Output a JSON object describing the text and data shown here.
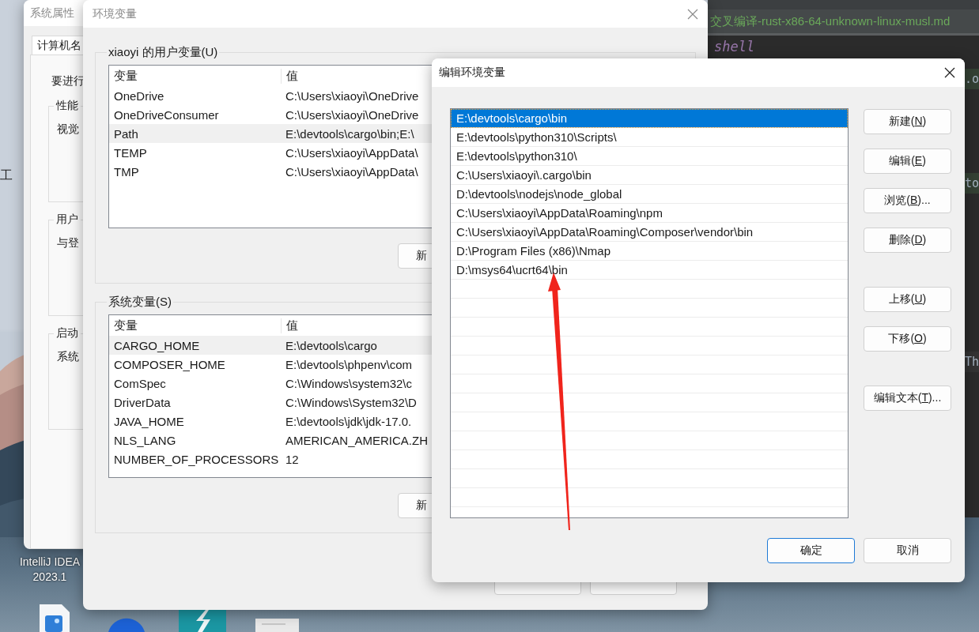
{
  "desktop": {
    "edge_label": "工",
    "shortcut": {
      "lines": [
        "IntelliJ IDEA",
        "2023.1"
      ]
    }
  },
  "ide": {
    "tab": {
      "label": "交叉编译-rust-x86-64-unknown-linux-musl.md",
      "selected": true
    },
    "lines": [
      {
        "text": "shell",
        "kind": "keyword",
        "highlighted": false
      },
      {
        "text": ".o",
        "kind": "edge",
        "highlighted": true
      },
      {
        "text": "to",
        "kind": "edge",
        "highlighted": true
      },
      {
        "text": "Th",
        "kind": "edge",
        "highlighted": false
      }
    ]
  },
  "system_properties": {
    "title": "系统属性",
    "tabs": [
      {
        "label": "计算机名",
        "selected": true
      }
    ],
    "intro": "要进行",
    "groups": [
      {
        "title": "性能",
        "text": "视觉"
      },
      {
        "title": "用户",
        "text": "与登"
      },
      {
        "title": "启动",
        "text": "系统"
      }
    ]
  },
  "env_window": {
    "title": "环境变量",
    "sections": [
      {
        "title": "xiaoyi 的用户变量(U)",
        "columns": [
          "变量",
          "值"
        ],
        "button": "新",
        "rows": [
          {
            "name": "OneDrive",
            "value": "C:\\Users\\xiaoyi\\OneDrive",
            "selected": false
          },
          {
            "name": "OneDriveConsumer",
            "value": "C:\\Users\\xiaoyi\\OneDrive",
            "selected": false
          },
          {
            "name": "Path",
            "value": "E:\\devtools\\cargo\\bin;E:\\",
            "selected": true
          },
          {
            "name": "TEMP",
            "value": "C:\\Users\\xiaoyi\\AppData\\",
            "selected": false
          },
          {
            "name": "TMP",
            "value": "C:\\Users\\xiaoyi\\AppData\\",
            "selected": false
          }
        ]
      },
      {
        "title": "系统变量(S)",
        "columns": [
          "变量",
          "值"
        ],
        "button": "新",
        "rows": [
          {
            "name": "CARGO_HOME",
            "value": "E:\\devtools\\cargo",
            "selected": true
          },
          {
            "name": "COMPOSER_HOME",
            "value": "E:\\devtools\\phpenv\\com",
            "selected": false
          },
          {
            "name": "ComSpec",
            "value": "C:\\Windows\\system32\\c",
            "selected": false
          },
          {
            "name": "DriverData",
            "value": "C:\\Windows\\System32\\D",
            "selected": false
          },
          {
            "name": "JAVA_HOME",
            "value": "E:\\devtools\\jdk\\jdk-17.0.",
            "selected": false
          },
          {
            "name": "NLS_LANG",
            "value": "AMERICAN_AMERICA.ZH",
            "selected": false
          },
          {
            "name": "NUMBER_OF_PROCESSORS",
            "value": "12",
            "selected": false
          }
        ]
      }
    ]
  },
  "edit_dialog": {
    "title": "编辑环境变量",
    "paths": [
      {
        "text": "E:\\devtools\\cargo\\bin",
        "selected": true
      },
      {
        "text": "E:\\devtools\\python310\\Scripts\\",
        "selected": false
      },
      {
        "text": "E:\\devtools\\python310\\",
        "selected": false
      },
      {
        "text": "C:\\Users\\xiaoyi\\.cargo\\bin",
        "selected": false
      },
      {
        "text": "D:\\devtools\\nodejs\\node_global",
        "selected": false
      },
      {
        "text": "C:\\Users\\xiaoyi\\AppData\\Roaming\\npm",
        "selected": false
      },
      {
        "text": "C:\\Users\\xiaoyi\\AppData\\Roaming\\Composer\\vendor\\bin",
        "selected": false
      },
      {
        "text": "D:\\Program Files (x86)\\Nmap",
        "selected": false
      },
      {
        "text": "D:\\msys64\\ucrt64\\bin",
        "selected": false
      }
    ],
    "button_groups": [
      [
        {
          "label": [
            "新建(",
            "N",
            ")"
          ]
        },
        {
          "label": [
            "编辑(",
            "E",
            ")"
          ]
        },
        {
          "label": [
            "浏览(",
            "B",
            ")..."
          ]
        },
        {
          "label": [
            "删除(",
            "D",
            ")"
          ]
        }
      ],
      [
        {
          "label": [
            "上移(",
            "U",
            ")"
          ]
        },
        {
          "label": [
            "下移(",
            "O",
            ")"
          ]
        }
      ],
      [
        {
          "label": [
            "编辑文本(",
            "T",
            ")..."
          ]
        }
      ]
    ],
    "footer_buttons": [
      {
        "label": "确定",
        "default": true
      },
      {
        "label": "取消",
        "default": false
      }
    ]
  }
}
